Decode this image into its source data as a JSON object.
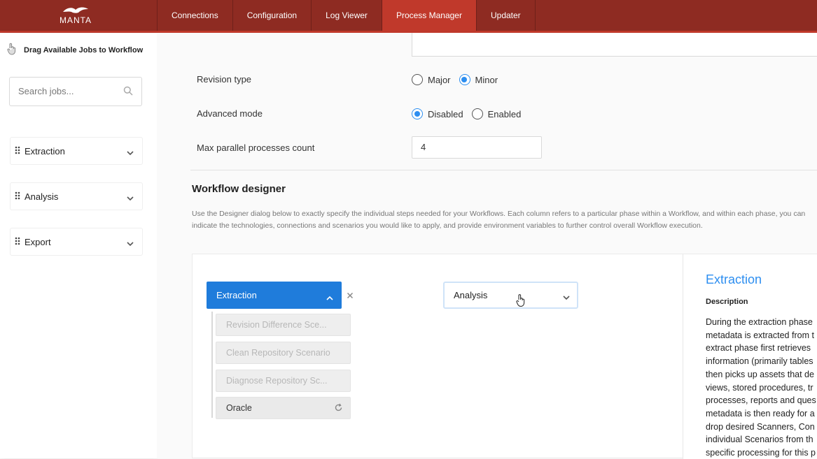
{
  "app": {
    "logo_text": "MANTA"
  },
  "nav": {
    "items": [
      {
        "label": "Connections"
      },
      {
        "label": "Configuration"
      },
      {
        "label": "Log Viewer"
      },
      {
        "label": "Process Manager"
      },
      {
        "label": "Updater"
      }
    ],
    "active": "Process Manager"
  },
  "sidebar": {
    "drag_hint": "Drag Available Jobs to Workflow",
    "search_placeholder": "Search jobs...",
    "categories": [
      {
        "label": "Extraction"
      },
      {
        "label": "Analysis"
      },
      {
        "label": "Export"
      }
    ]
  },
  "form": {
    "revision_type": {
      "label": "Revision type",
      "options": [
        "Major",
        "Minor"
      ],
      "selected": "Minor"
    },
    "advanced_mode": {
      "label": "Advanced mode",
      "options": [
        "Disabled",
        "Enabled"
      ],
      "selected": "Disabled"
    },
    "max_parallel": {
      "label": "Max parallel processes count",
      "value": "4"
    }
  },
  "workflow": {
    "title": "Workflow designer",
    "description": "Use the Designer dialog below to exactly specify the individual steps needed for your Workflows. Each column refers to a particular phase within a Workflow, and within each phase, you can indicate the technologies, connections and scenarios you would like to apply, and provide environment variables to further control overall Workflow execution.",
    "phases": [
      {
        "label": "Extraction",
        "jobs": [
          {
            "label": "Revision Difference Sce...",
            "enabled": false
          },
          {
            "label": "Clean Repository Scenario",
            "enabled": false
          },
          {
            "label": "Diagnose Repository Sc...",
            "enabled": false
          },
          {
            "label": "Oracle",
            "enabled": true
          }
        ]
      },
      {
        "label": "Analysis"
      }
    ]
  },
  "info": {
    "title": "Extraction",
    "desc_label": "Description",
    "lines": [
      "During the extraction phase",
      "metadata is extracted from t",
      "extract phase first retrieves",
      "information (primarily tables",
      "then picks up assets that de",
      "views, stored procedures, tr",
      "processes, reports and ques",
      "metadata is then ready for a",
      "drop desired Scanners, Con",
      "individual Scenarios from th",
      "specific processing for this p"
    ]
  },
  "colors": {
    "nav_bg": "#8e2b22",
    "nav_active": "#c0392b",
    "primary": "#1f7cdb",
    "accent": "#2d8ef0"
  }
}
